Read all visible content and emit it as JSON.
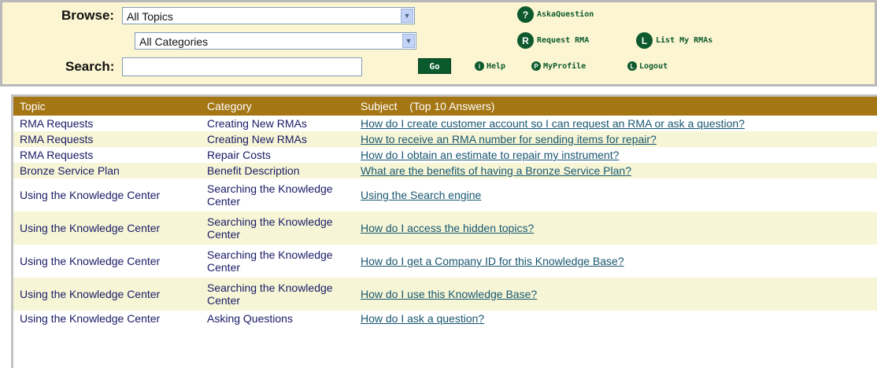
{
  "header": {
    "browse_label": "Browse:",
    "topic_select": {
      "value": "All Topics"
    },
    "category_select": {
      "value": "All Categories"
    },
    "search_label": "Search:",
    "search_value": "",
    "go_label": "Go",
    "actions": {
      "ask": {
        "icon": "?",
        "label": "AskaQuestion"
      },
      "request_rma": {
        "icon": "R",
        "label": "Request RMA"
      },
      "list_rmas": {
        "icon": "L",
        "label": "List My RMAs"
      },
      "help": {
        "icon": "i",
        "label": "Help"
      },
      "profile": {
        "icon": "P",
        "label": "MyProfile"
      },
      "logout": {
        "icon": "L",
        "label": "Logout"
      }
    }
  },
  "table": {
    "columns": {
      "topic": "Topic",
      "category": "Category",
      "subject": "Subject",
      "subject_note": "(Top 10 Answers)"
    },
    "rows": [
      {
        "topic": "RMA Requests",
        "category": "Creating New RMAs",
        "subject": "How do I create customer account so I can request an RMA or ask a question?"
      },
      {
        "topic": "RMA Requests",
        "category": "Creating New RMAs",
        "subject": "How to receive an RMA number for sending items for repair?"
      },
      {
        "topic": "RMA Requests",
        "category": "Repair Costs",
        "subject": "How do I obtain an estimate to repair my instrument?"
      },
      {
        "topic": "Bronze Service Plan",
        "category": "Benefit Description",
        "subject": "What are the benefits of having a Bronze Service Plan?"
      },
      {
        "topic": "Using the Knowledge Center",
        "category": "Searching the Knowledge Center",
        "subject": "Using the Search engine"
      },
      {
        "topic": "Using the Knowledge Center",
        "category": "Searching the Knowledge Center",
        "subject": "How do I access the hidden topics?"
      },
      {
        "topic": "Using the Knowledge Center",
        "category": "Searching the Knowledge Center",
        "subject": "How do I get a Company ID for this Knowledge Base?"
      },
      {
        "topic": "Using the Knowledge Center",
        "category": "Searching the Knowledge Center",
        "subject": "How do I use this Knowledge Base?"
      },
      {
        "topic": "Using the Knowledge Center",
        "category": "Asking Questions",
        "subject": "How do I ask a question?"
      }
    ]
  }
}
